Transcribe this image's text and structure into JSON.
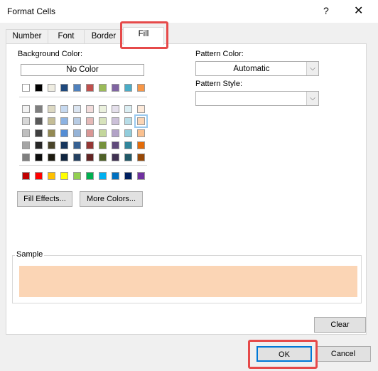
{
  "window": {
    "title": "Format Cells",
    "help": "?",
    "close": "✕"
  },
  "tabs": [
    {
      "label": "Number"
    },
    {
      "label": "Font"
    },
    {
      "label": "Border"
    },
    {
      "label": "Fill",
      "active": true
    }
  ],
  "fill": {
    "background_color_label": "Background Color:",
    "no_color_label": "No Color",
    "theme_top_row": [
      "#ffffff",
      "#000000",
      "#eeece1",
      "#1f497d",
      "#4f81bd",
      "#c0504d",
      "#9bbb59",
      "#8064a2",
      "#4bacc6",
      "#f79646"
    ],
    "theme_shades": [
      [
        "#f2f2f2",
        "#7f7f7f",
        "#ddd9c3",
        "#c6d9f0",
        "#dbe5f1",
        "#f2dcdb",
        "#ebf1dd",
        "#e5e0ec",
        "#dbeef3",
        "#fdeada"
      ],
      [
        "#d8d8d8",
        "#595959",
        "#c4bd97",
        "#8db3e2",
        "#b8cce4",
        "#e5b9b7",
        "#d7e3bc",
        "#ccc1d9",
        "#b7dde8",
        "#fbd5b5"
      ],
      [
        "#bfbfbf",
        "#3f3f3f",
        "#938953",
        "#548dd4",
        "#95b3d7",
        "#d99694",
        "#c3d69b",
        "#b2a2c7",
        "#92cddc",
        "#fac08f"
      ],
      [
        "#a5a5a5",
        "#262626",
        "#494429",
        "#17365d",
        "#366092",
        "#953734",
        "#76923c",
        "#5f497a",
        "#31859b",
        "#e36c09"
      ],
      [
        "#7f7f7f",
        "#0c0c0c",
        "#1d1b10",
        "#0f243e",
        "#244061",
        "#632423",
        "#4f6128",
        "#3f3151",
        "#205867",
        "#974806"
      ]
    ],
    "standard_colors": [
      "#c00000",
      "#ff0000",
      "#ffc000",
      "#ffff00",
      "#92d050",
      "#00b050",
      "#00b0f0",
      "#0070c0",
      "#002060",
      "#7030a0"
    ],
    "selected_color": "#fbd5b5",
    "fill_effects_label": "Fill Effects...",
    "more_colors_label": "More Colors...",
    "pattern_color_label": "Pattern Color:",
    "pattern_color_value": "Automatic",
    "pattern_style_label": "Pattern Style:",
    "pattern_style_value": "",
    "sample_label": "Sample",
    "clear_label": "Clear"
  },
  "footer": {
    "ok_label": "OK",
    "cancel_label": "Cancel"
  }
}
